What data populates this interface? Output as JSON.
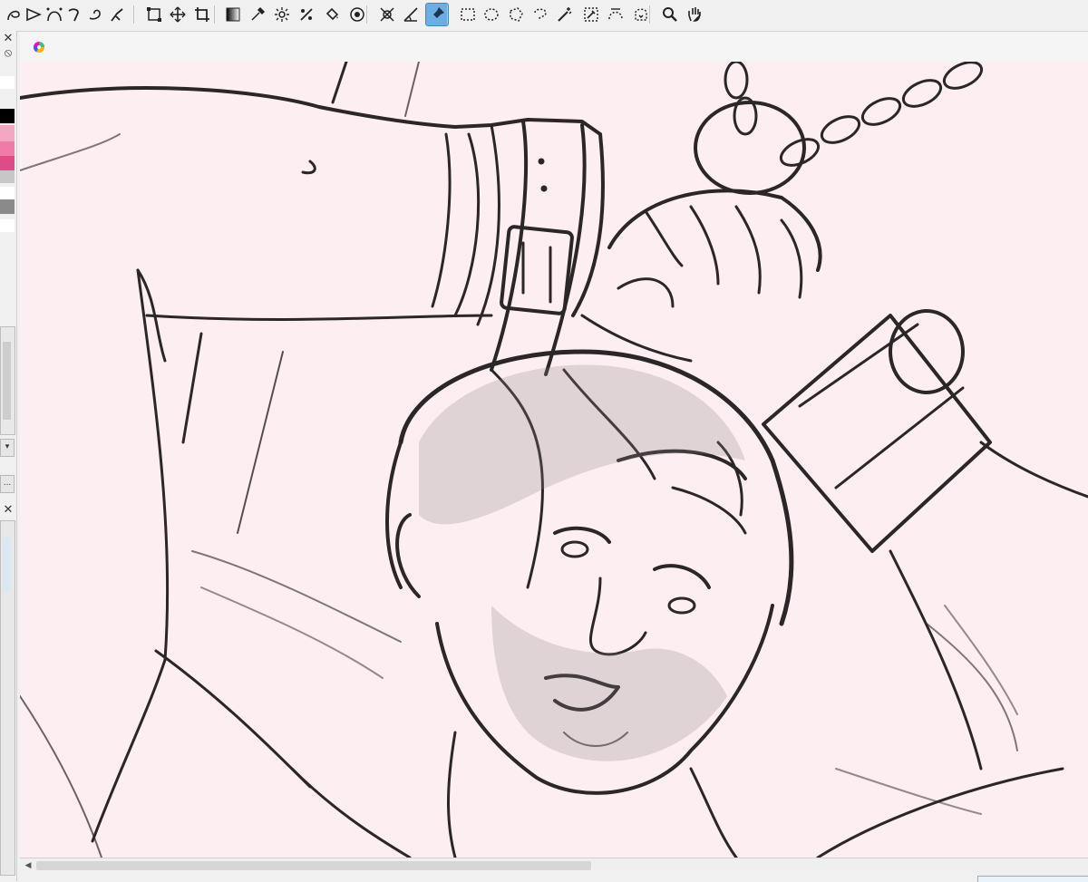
{
  "app": {
    "accent": "#6aaee4",
    "canvas_bg": "#fdeef1"
  },
  "toolbar": {
    "tools": [
      {
        "name": "freehand-selection-icon"
      },
      {
        "name": "polyline-icon"
      },
      {
        "name": "bezier-path-icon"
      },
      {
        "name": "calligraphy-icon"
      },
      {
        "name": "freehand-brush-icon"
      },
      {
        "name": "dynamic-brush-icon"
      },
      {
        "name": "transform-icon"
      },
      {
        "name": "move-icon"
      },
      {
        "name": "crop-icon"
      },
      {
        "name": "gradient-icon"
      },
      {
        "name": "color-picker-icon"
      },
      {
        "name": "smart-patch-icon"
      },
      {
        "name": "multibrush-icon"
      },
      {
        "name": "fill-bucket-icon"
      },
      {
        "name": "colorize-mask-icon"
      },
      {
        "name": "assistant-icon"
      },
      {
        "name": "measure-icon"
      },
      {
        "name": "reference-pin-icon",
        "active": true
      },
      {
        "name": "rectangle-selection-icon"
      },
      {
        "name": "ellipse-selection-icon"
      },
      {
        "name": "polygon-selection-icon"
      },
      {
        "name": "lasso-selection-icon"
      },
      {
        "name": "magic-wand-icon"
      },
      {
        "name": "similar-color-selection-icon"
      },
      {
        "name": "bezier-selection-icon"
      },
      {
        "name": "magnetic-selection-icon"
      },
      {
        "name": "zoom-icon"
      },
      {
        "name": "pan-icon"
      }
    ]
  },
  "palette": {
    "swatches": [
      "#ffffff",
      "#000000",
      "#f4a6c2",
      "#f07aa8",
      "#e04a86",
      "#c7c7c7",
      "#ffffff",
      "#8a8a8a",
      "#ffffff"
    ]
  },
  "dock": {
    "button_label": "..."
  },
  "document": {
    "tab_icon": "krita-doc-icon"
  }
}
